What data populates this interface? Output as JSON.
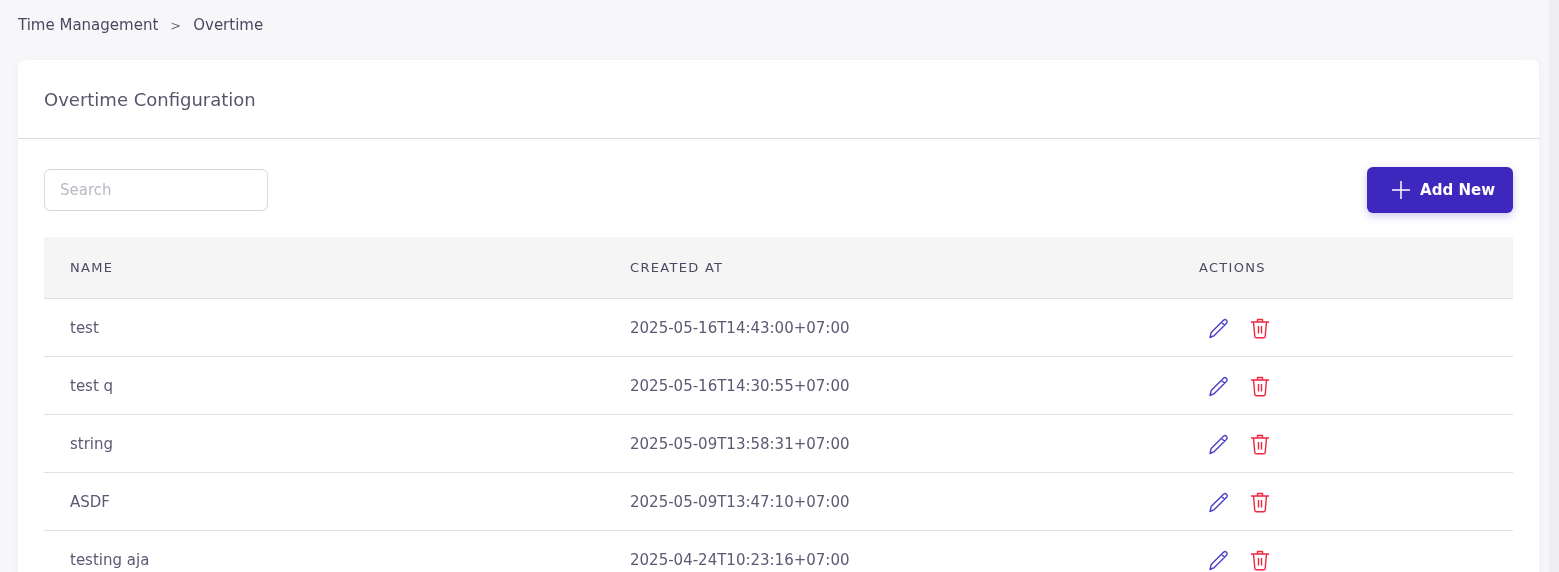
{
  "breadcrumb": {
    "items": [
      "Time Management",
      "Overtime"
    ],
    "separator": ">"
  },
  "card": {
    "title": "Overtime Configuration"
  },
  "search": {
    "placeholder": "Search"
  },
  "add_button": {
    "label": "Add New"
  },
  "table": {
    "columns": [
      "NAME",
      "CREATED AT",
      "ACTIONS"
    ],
    "rows": [
      {
        "name": "test",
        "created_at": "2025-05-16T14:43:00+07:00"
      },
      {
        "name": "test q",
        "created_at": "2025-05-16T14:30:55+07:00"
      },
      {
        "name": "string",
        "created_at": "2025-05-09T13:58:31+07:00"
      },
      {
        "name": "ASDF",
        "created_at": "2025-05-09T13:47:10+07:00"
      },
      {
        "name": "testing aja",
        "created_at": "2025-04-24T10:23:16+07:00"
      }
    ]
  }
}
